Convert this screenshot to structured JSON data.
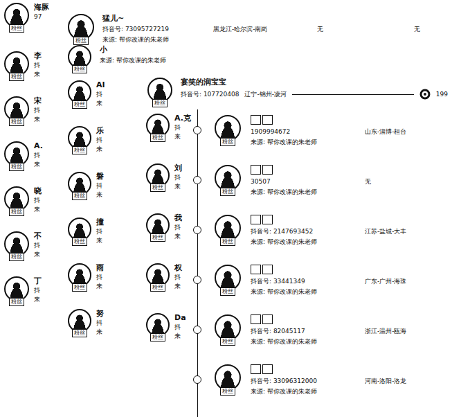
{
  "badge": "粉丝",
  "column_a": [
    {
      "name": "海豚",
      "lines": [
        "97"
      ]
    },
    {
      "name": "李",
      "lines": [
        "抖",
        "来"
      ]
    },
    {
      "name": "宋",
      "lines": [
        "抖",
        "来"
      ]
    },
    {
      "name": "A.",
      "lines": [
        "抖",
        "来"
      ]
    },
    {
      "name": "晓",
      "lines": [
        "抖",
        "来"
      ]
    },
    {
      "name": "不",
      "lines": [
        "抖",
        "来"
      ]
    },
    {
      "name": "丁",
      "lines": [
        "抖",
        "来"
      ]
    }
  ],
  "b_header": {
    "name": "猛儿~",
    "douyin": "抖音号: 73095727219",
    "location": "黑龙江-哈尔滨-南岗",
    "fields": [
      "无",
      "无"
    ],
    "source": "来源: 帮你改课的朱老师"
  },
  "b_second": {
    "name": "小",
    "source": "来源: 帮你改课的朱老师"
  },
  "b_rows": [
    {
      "name": "AI",
      "lines": [
        "抖",
        "来"
      ]
    },
    {
      "name": "乐",
      "lines": [
        "抖",
        "来"
      ]
    },
    {
      "name": "磐",
      "lines": [
        "抖",
        "来"
      ]
    },
    {
      "name": "撞",
      "lines": [
        "抖",
        "来"
      ]
    },
    {
      "name": "雨",
      "lines": [
        "抖",
        "来"
      ]
    },
    {
      "name": "努",
      "lines": [
        "抖",
        "来"
      ]
    }
  ],
  "c_header": {
    "name": "宴笑的润宝宝",
    "douyin": "抖音号: 107720408",
    "location": "辽宁-锦州-凌河",
    "extra": "199"
  },
  "c_rows": [
    {
      "name": "A.克",
      "lines": [
        "抖",
        "来"
      ]
    },
    {
      "name": "刘",
      "lines": [
        "抖",
        "来"
      ]
    },
    {
      "name": "我",
      "lines": [
        "抖",
        "来"
      ]
    },
    {
      "name": "权",
      "lines": [
        "抖",
        "来"
      ]
    },
    {
      "name": "Da",
      "lines": [
        "抖",
        "来"
      ]
    }
  ],
  "d_rows": [
    {
      "douyin": "1909994672",
      "location": "山东-淄博-桓台",
      "source": "来源: 帮你改课的朱老师"
    },
    {
      "douyin": "30507",
      "location": "无",
      "source": "来源: 帮你改课的朱老师"
    },
    {
      "douyin": "抖音号: 2147693452",
      "location": "江苏-盐城-大丰",
      "source": "来源: 帮你改课的朱老师"
    },
    {
      "douyin": "抖音号: 33441349",
      "location": "广东-广州-海珠",
      "source": "来源: 帮你改课的朱老师"
    },
    {
      "douyin": "抖音号: 82045117",
      "location": "浙江-温州-瓯海",
      "source": "来源: 帮你改课的朱老师"
    },
    {
      "douyin": "抖音号: 33096312000",
      "location": "河南-洛阳-洛龙",
      "source": "来源: 帮你改课的朱老师"
    }
  ]
}
